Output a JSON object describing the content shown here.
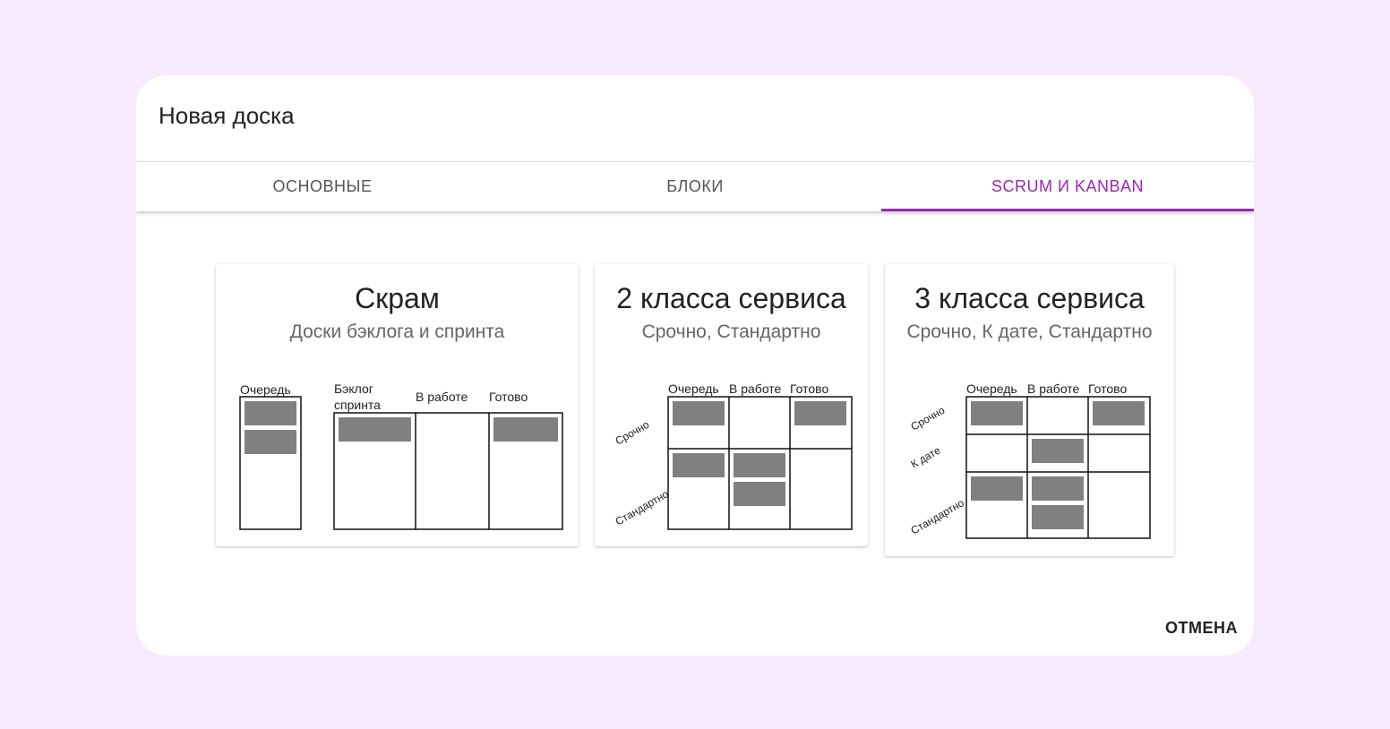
{
  "dialog": {
    "title": "Новая доска"
  },
  "tabs": [
    {
      "label": "ОСНОВНЫЕ",
      "active": false
    },
    {
      "label": "БЛОКИ",
      "active": false
    },
    {
      "label": "SCRUM И KANBAN",
      "active": true
    }
  ],
  "accent_color": "#9c27b0",
  "cards": [
    {
      "title": "Скрам",
      "subtitle": "Доски бэклога и спринта",
      "columns": [
        "Очередь",
        "Бэклог",
        "спринта",
        "В работе",
        "Готово"
      ]
    },
    {
      "title": "2 класса сервиса",
      "subtitle": "Срочно, Стандартно",
      "columns": [
        "Очередь",
        "В работе",
        "Готово"
      ],
      "rows": [
        "Срочно",
        "Стандартно"
      ]
    },
    {
      "title": "3 класса сервиса",
      "subtitle": "Срочно, К дате, Стандартно",
      "columns": [
        "Очередь",
        "В работе",
        "Готово"
      ],
      "rows": [
        "Срочно",
        "К дате",
        "Стандартно"
      ]
    }
  ],
  "actions": {
    "cancel_label": "ОТМЕНА"
  }
}
